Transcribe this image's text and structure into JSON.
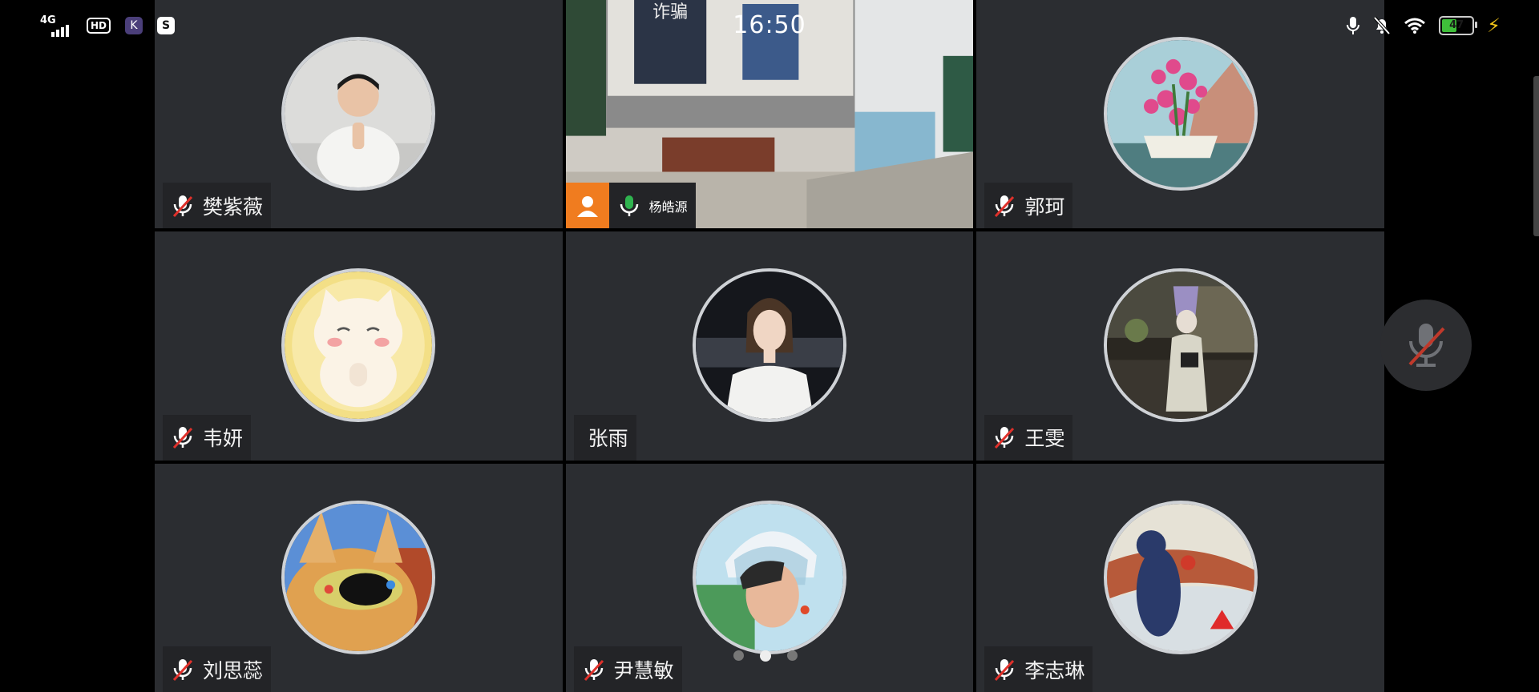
{
  "status_bar": {
    "time": "16:50",
    "network": "4G",
    "hd_badge": "HD",
    "app_icon_1": "K",
    "app_icon_2": "S",
    "battery_level": "47",
    "icons": [
      "signal-icon",
      "hd-icon",
      "kuaishou-app-icon",
      "app-notification-icon",
      "mic-status-icon",
      "silent-bell-icon",
      "wifi-icon",
      "battery-icon",
      "charging-bolt-icon"
    ]
  },
  "participants": [
    {
      "name": "樊紫薇",
      "muted": true,
      "type": "avatar",
      "avatar": "boy-praying"
    },
    {
      "name": "杨皓源",
      "muted": false,
      "type": "video",
      "speaking": true
    },
    {
      "name": "郭珂",
      "muted": true,
      "type": "avatar",
      "avatar": "flowers-painting"
    },
    {
      "name": "韦妍",
      "muted": true,
      "type": "avatar",
      "avatar": "cartoon-cat"
    },
    {
      "name": "张雨",
      "muted": null,
      "type": "avatar",
      "avatar": "woman-portrait"
    },
    {
      "name": "王雯",
      "muted": true,
      "type": "avatar",
      "avatar": "night-street"
    },
    {
      "name": "刘思蕊",
      "muted": true,
      "type": "avatar",
      "avatar": "dog-sunglasses"
    },
    {
      "name": "尹慧敏",
      "muted": true,
      "type": "avatar",
      "avatar": "helmet-boy"
    },
    {
      "name": "李志琳",
      "muted": true,
      "type": "avatar",
      "avatar": "bear-painting"
    }
  ],
  "video_screen_text": "诈骗",
  "floating_button": {
    "icon": "mic-muted-icon",
    "state": "muted"
  },
  "pagination": {
    "pages": 3,
    "current": 2
  },
  "colors": {
    "tile_bg": "#2b2d31",
    "speaking_border": "#2fb34f",
    "mute_red": "#e0312b",
    "active_mic": "#2fb34f",
    "badge_orange": "#f07c1f"
  }
}
